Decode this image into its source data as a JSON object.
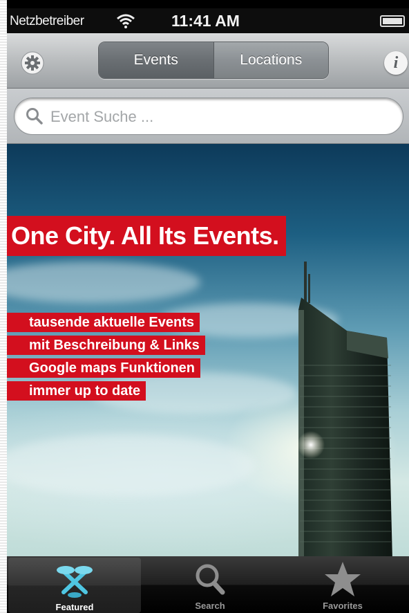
{
  "status_bar": {
    "carrier": "Netzbetreiber",
    "time": "11:41 AM",
    "wifi_icon": "wifi-icon",
    "battery_icon": "battery-icon"
  },
  "nav": {
    "settings_icon": "gear-icon",
    "segments": [
      "Events",
      "Locations"
    ],
    "selected_segment": "Events",
    "info_label": "i"
  },
  "search": {
    "placeholder": "Event Suche ...",
    "value": ""
  },
  "hero": {
    "tagline": "One City. All Its Events.",
    "features": [
      "tausende aktuelle Events",
      "mit Beschreibung & Links",
      "Google maps Funktionen",
      "immer up to date"
    ]
  },
  "tabs": [
    {
      "label": "Featured",
      "icon": "featured-icon",
      "active": true
    },
    {
      "label": "Search",
      "icon": "search-icon",
      "active": false
    },
    {
      "label": "Favorites",
      "icon": "star-icon",
      "active": false
    }
  ],
  "colors": {
    "accent_red": "#d30f1e",
    "tab_active_icon": "#5fd0e8"
  }
}
